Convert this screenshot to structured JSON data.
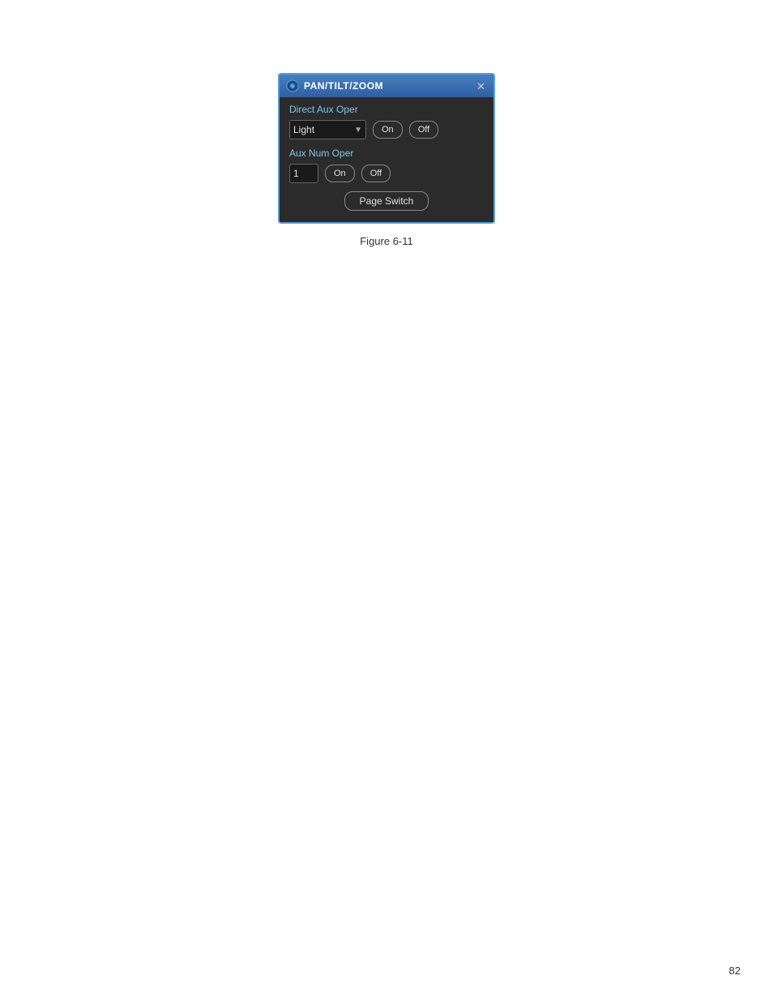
{
  "page": {
    "number": "82"
  },
  "figure": {
    "caption": "Figure 6-11"
  },
  "dialog": {
    "title": "PAN/TILT/ZOOM",
    "close_label": "✕",
    "direct_aux_label": "Direct Aux Oper",
    "dropdown_value": "Light",
    "dropdown_arrow": "▼",
    "on_label_1": "On",
    "off_label_1": "Off",
    "aux_num_label": "Aux Num Oper",
    "num_input_value": "1",
    "on_label_2": "On",
    "off_label_2": "Off",
    "page_switch_label": "Page Switch"
  }
}
